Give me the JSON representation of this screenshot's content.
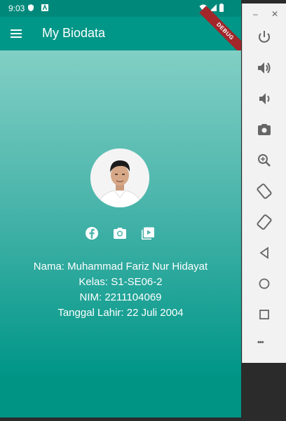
{
  "status_bar": {
    "time": "9:03"
  },
  "app_bar": {
    "title": "My Biodata",
    "debug_label": "DEBUG"
  },
  "profile": {
    "nama": "Nama: Muhammad Fariz Nur Hidayat",
    "kelas": "Kelas: S1-SE06-2",
    "nim": "NIM: 2211104069",
    "tanggal_lahir": "Tanggal Lahir: 22 Juli 2004"
  },
  "social_links": [
    "facebook-icon",
    "instagram-icon",
    "youtube-icon"
  ],
  "emulator_toolbar": {
    "window_controls": [
      "–",
      "✕"
    ],
    "buttons": [
      "power",
      "volume-up",
      "volume-down",
      "screenshot",
      "zoom",
      "rotate-left",
      "rotate-right",
      "back",
      "home",
      "overview",
      "more"
    ],
    "more_label": "•••"
  },
  "colors": {
    "app_bar": "#009688",
    "status_bar": "#00897b",
    "gradient_top": "#82cfc5",
    "gradient_bottom": "#009688"
  }
}
